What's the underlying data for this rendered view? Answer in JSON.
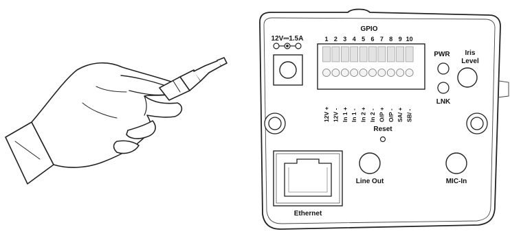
{
  "colors": {
    "line": "#222222",
    "panel_fill": "#ffffff",
    "terminal_fill": "#e3e3e3",
    "terminal_hole": "#f4f4f4"
  },
  "power": {
    "rating": "12V⎓1.5A"
  },
  "gpio": {
    "title": "GPIO",
    "pin_numbers": [
      "1",
      "2",
      "3",
      "4",
      "5",
      "6",
      "7",
      "8",
      "9",
      "10"
    ],
    "pin_labels": [
      "12V +",
      "12V -",
      "In 1 +",
      "In 1 -",
      "In 2 +",
      "In 2 -",
      "O/P +",
      "O/P -",
      "SA/ +",
      "SB/ -"
    ]
  },
  "indicators": {
    "pwr": "PWR",
    "lnk": "LNK"
  },
  "iris": {
    "label_line1": "Iris",
    "label_line2": "Level"
  },
  "reset": {
    "label": "Reset"
  },
  "ports": {
    "line_out": "Line Out",
    "mic_in": "MIC-In",
    "ethernet": "Ethernet"
  },
  "illustration": {
    "hand": "hand-inserting-plug-icon"
  }
}
